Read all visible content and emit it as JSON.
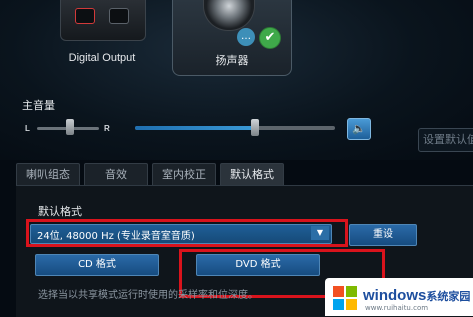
{
  "devices": {
    "digital_output": {
      "label": "Digital Output"
    },
    "speaker": {
      "label": "扬声器"
    }
  },
  "master_volume": {
    "label": "主音量",
    "balance_left": "L",
    "balance_right": "R",
    "balance_position": 0.5,
    "level": 0.6
  },
  "set_default_button": {
    "label": "设置默认值"
  },
  "tabs": [
    {
      "label": "喇叭组态",
      "active": false
    },
    {
      "label": "音效",
      "active": false
    },
    {
      "label": "室内校正",
      "active": false
    },
    {
      "label": "默认格式",
      "active": true
    }
  ],
  "default_format": {
    "label": "默认格式",
    "selected_value": "24位, 48000 Hz (专业录音室音质)",
    "reset_button": "重设",
    "cd_button": "CD 格式",
    "dvd_button": "DVD 格式",
    "hint": "选择当以共享模式运行时使用的采样率和位深度。"
  },
  "watermark": {
    "text": "windows",
    "suffix": "系统家园",
    "url": "www.ruihaitu.com"
  },
  "colors": {
    "highlight_red": "#d9131c",
    "accent_blue": "#1f5f97",
    "check_green": "#3fa94a"
  }
}
